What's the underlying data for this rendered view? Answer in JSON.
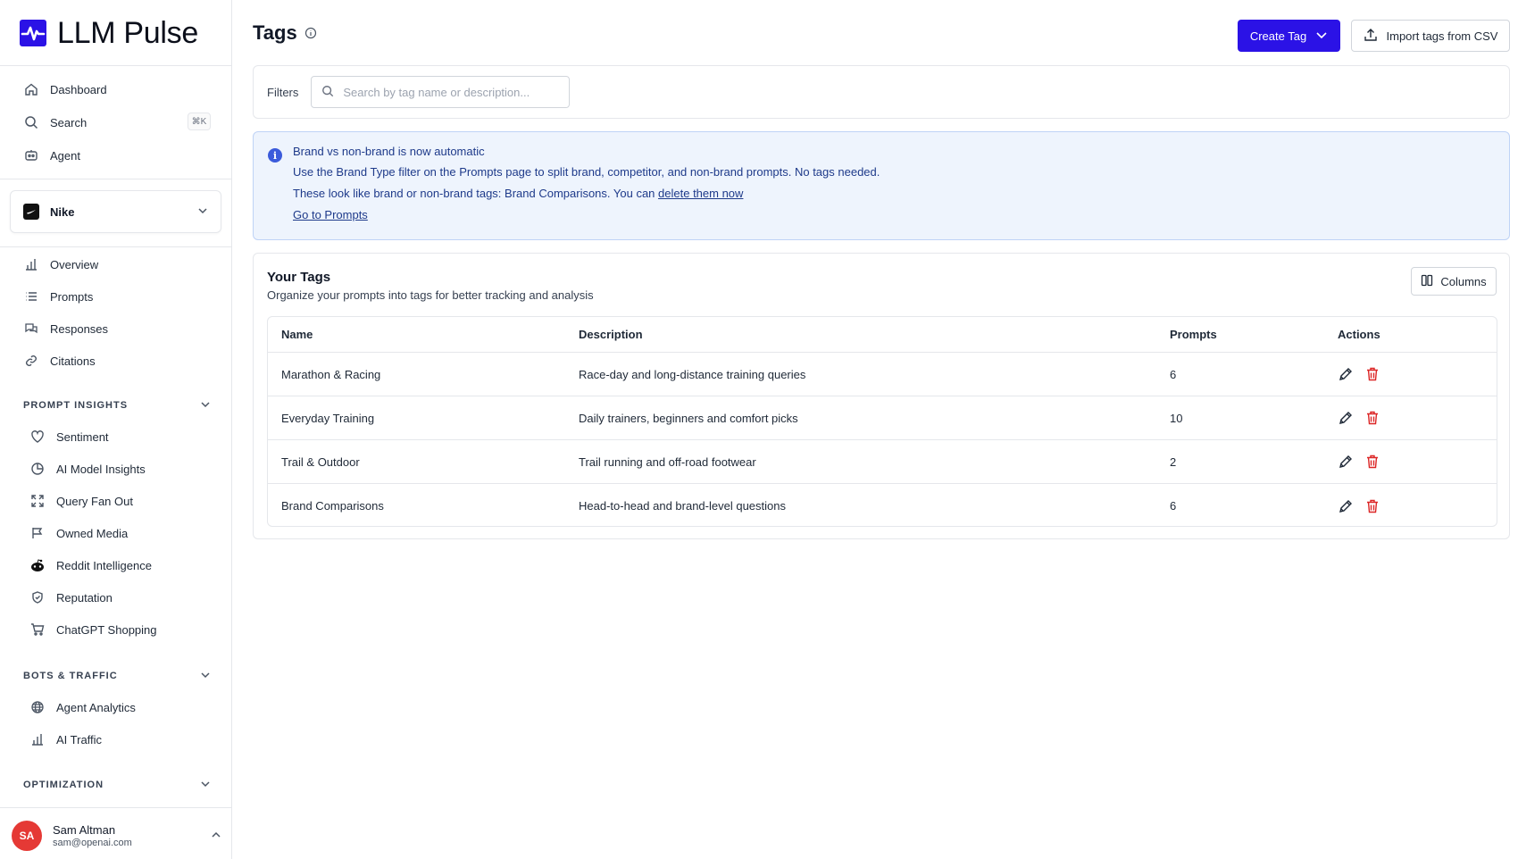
{
  "app": {
    "name": "LLM Pulse"
  },
  "sidebar": {
    "top_items": [
      {
        "label": "Dashboard",
        "icon": "home-icon"
      },
      {
        "label": "Search",
        "icon": "search-icon",
        "shortcut": "⌘K"
      },
      {
        "label": "Agent",
        "icon": "agent-icon"
      }
    ],
    "project": {
      "name": "Nike"
    },
    "project_items": [
      {
        "label": "Overview",
        "icon": "bar-chart-icon"
      },
      {
        "label": "Prompts",
        "icon": "list-icon"
      },
      {
        "label": "Responses",
        "icon": "chat-bubbles-icon"
      },
      {
        "label": "Citations",
        "icon": "link-icon"
      }
    ],
    "sections": {
      "prompt_insights": {
        "title": "PROMPT INSIGHTS",
        "items": [
          {
            "label": "Sentiment",
            "icon": "heart-icon"
          },
          {
            "label": "AI Model Insights",
            "icon": "pie-chart-icon"
          },
          {
            "label": "Query Fan Out",
            "icon": "expand-icon"
          },
          {
            "label": "Owned Media",
            "icon": "media-icon"
          },
          {
            "label": "Reddit Intelligence",
            "icon": "reddit-icon"
          },
          {
            "label": "Reputation",
            "icon": "shield-icon"
          },
          {
            "label": "ChatGPT Shopping",
            "icon": "cart-icon"
          }
        ]
      },
      "bots_traffic": {
        "title": "BOTS & TRAFFIC",
        "items": [
          {
            "label": "Agent Analytics",
            "icon": "globe-icon"
          },
          {
            "label": "AI Traffic",
            "icon": "bar-chart-icon"
          }
        ]
      },
      "optimization": {
        "title": "OPTIMIZATION"
      }
    },
    "user": {
      "initials": "SA",
      "name": "Sam Altman",
      "email": "sam@openai.com"
    }
  },
  "header": {
    "title": "Tags",
    "create_label": "Create Tag",
    "import_label": "Import tags from CSV"
  },
  "filters": {
    "label": "Filters",
    "search_placeholder": "Search by tag name or description..."
  },
  "notice": {
    "title": "Brand vs non-brand is now automatic",
    "line1": "Use the Brand Type filter on the Prompts page to split brand, competitor, and non-brand prompts. No tags needed.",
    "line2_prefix": "These look like brand or non-brand tags: Brand Comparisons. You can ",
    "line2_link": "delete them now",
    "link": "Go to Prompts"
  },
  "tags": {
    "title": "Your Tags",
    "subtitle": "Organize your prompts into tags for better tracking and analysis",
    "columns_label": "Columns",
    "headers": [
      "Name",
      "Description",
      "Prompts",
      "Actions"
    ],
    "rows": [
      {
        "name": "Marathon & Racing",
        "description": "Race-day and long-distance training queries",
        "prompts": "6"
      },
      {
        "name": "Everyday Training",
        "description": "Daily trainers, beginners and comfort picks",
        "prompts": "10"
      },
      {
        "name": "Trail & Outdoor",
        "description": "Trail running and off-road footwear",
        "prompts": "2"
      },
      {
        "name": "Brand Comparisons",
        "description": "Head-to-head and brand-level questions",
        "prompts": "6"
      }
    ]
  },
  "colors": {
    "accent": "#2b12e6",
    "danger": "#dc2626",
    "info_bg": "#eef4fd"
  }
}
